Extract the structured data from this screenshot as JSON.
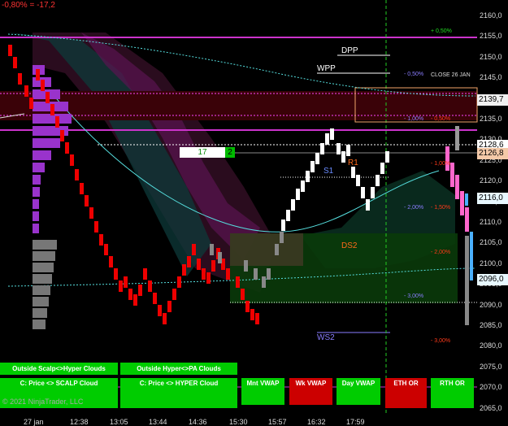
{
  "top_change": "-0,80% = -17,2",
  "copyright": "© 2021 NinjaTrader, LLC",
  "quantity_box": {
    "value": "17",
    "button": "2"
  },
  "price_axis": [
    "2160,0",
    "2155,0",
    "2150,0",
    "2145,0",
    "2140,0",
    "2135,0",
    "2130,0",
    "2125,0",
    "2120,0",
    "2115,0",
    "2110,0",
    "2105,0",
    "2100,0",
    "2095,0",
    "2090,0",
    "2085,0",
    "2080,0",
    "2075,0",
    "2070,0",
    "2065,0"
  ],
  "time_axis": [
    "27 jan",
    "12:38",
    "13:05",
    "13:44",
    "14:36",
    "15:30",
    "15:57",
    "16:32",
    "17:59"
  ],
  "price_markers": [
    {
      "label": "2139,7",
      "bg": "#f0f0f0",
      "fg": "#000"
    },
    {
      "label": "2128,6",
      "bg": "#ffffff",
      "fg": "#000"
    },
    {
      "label": "2126,8",
      "bg": "#f4c9a8",
      "fg": "#000"
    },
    {
      "label": "2116,0",
      "bg": "#e8f8ff",
      "fg": "#000"
    },
    {
      "label": "2096,0",
      "bg": "#e8f8ff",
      "fg": "#000"
    }
  ],
  "levels": [
    {
      "label": "DPP",
      "color": "#ffffff"
    },
    {
      "label": "WPP",
      "color": "#ffffff"
    },
    {
      "label": "S1",
      "color": "#6a8cff"
    },
    {
      "label": "DS2",
      "color": "#ff6a1a"
    },
    {
      "label": "WS2",
      "color": "#8a7dff"
    },
    {
      "label": "R1",
      "color": "#ff6a1a"
    }
  ],
  "close_label": "CLOSE 26 JAN",
  "percent_labels": [
    {
      "text": "+ 0,50%",
      "color": "#22dd22"
    },
    {
      "text": "- 0,50%",
      "color": "#8a7dff"
    },
    {
      "text": "- 1,00%",
      "color": "#8a7dff"
    },
    {
      "text": "- 0,50%",
      "color": "#ff3a1a"
    },
    {
      "text": "- 1,00%",
      "color": "#ff3a1a"
    },
    {
      "text": "- 2,00%",
      "color": "#8a7dff"
    },
    {
      "text": "- 1,50%",
      "color": "#ff3a1a"
    },
    {
      "text": "- 2,00%",
      "color": "#ff3a1a"
    },
    {
      "text": "- 3,00%",
      "color": "#8a7dff"
    },
    {
      "text": "- 3,00%",
      "color": "#ff3a1a"
    }
  ],
  "buttons": {
    "outside_scalp": "Outside Scalp<>Hyper Clouds",
    "outside_hyper": "Outside Hyper<>PA Clouds",
    "price_scalp": "C: Price <> SCALP Cloud",
    "price_hyper": "C: Price <> HYPER Cloud",
    "mnt_vwap": "Mnt VWAP",
    "wk_vwap": "Wk VWAP",
    "day_vwap": "Day VWAP",
    "eth_or": "ETH OR",
    "rth_or": "RTH OR"
  },
  "colors": {
    "green": "#00cc00",
    "red": "#cc0000",
    "magenta": "#cc33cc",
    "purple_bar": "#9933cc",
    "cyan": "#44dddd"
  }
}
